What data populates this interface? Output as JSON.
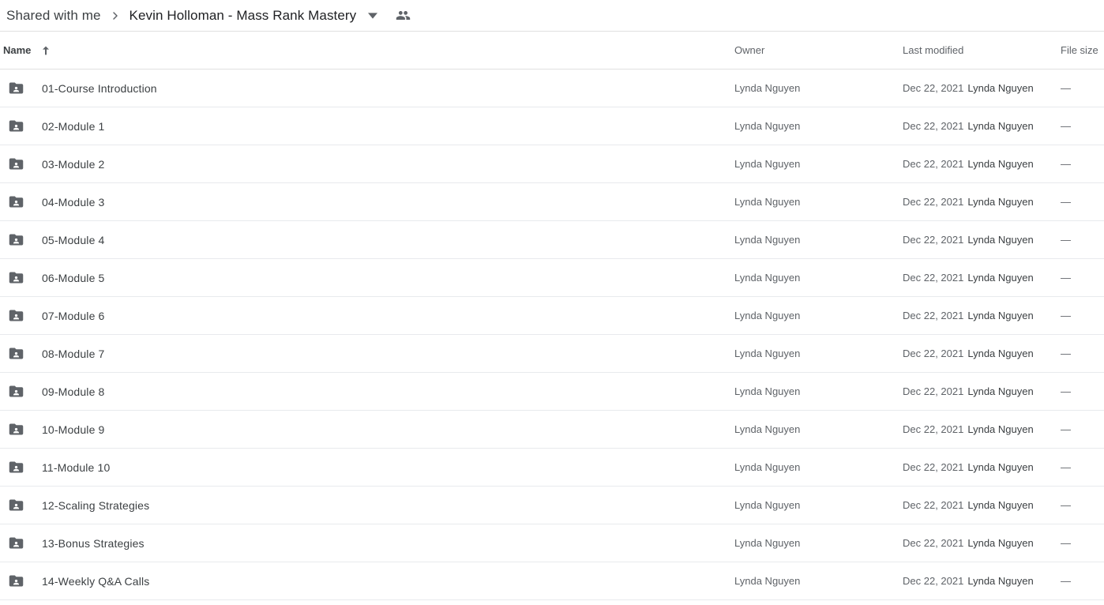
{
  "breadcrumb": {
    "root_label": "Shared with me",
    "separator_icon": "chevron-right-icon",
    "current_label": "Kevin Holloman - Mass Rank Mastery",
    "caret_icon": "chevron-down-icon",
    "people_icon": "people-icon"
  },
  "table": {
    "columns": {
      "name": "Name",
      "sort_icon": "arrow-up-icon",
      "owner": "Owner",
      "last_modified": "Last modified",
      "file_size": "File size"
    },
    "rows": [
      {
        "icon": "shared-folder-icon",
        "name": "01-Course Introduction",
        "owner": "Lynda Nguyen",
        "modified_date": "Dec 22, 2021",
        "modified_by": "Lynda Nguyen",
        "size": "—"
      },
      {
        "icon": "shared-folder-icon",
        "name": "02-Module 1",
        "owner": "Lynda Nguyen",
        "modified_date": "Dec 22, 2021",
        "modified_by": "Lynda Nguyen",
        "size": "—"
      },
      {
        "icon": "shared-folder-icon",
        "name": "03-Module 2",
        "owner": "Lynda Nguyen",
        "modified_date": "Dec 22, 2021",
        "modified_by": "Lynda Nguyen",
        "size": "—"
      },
      {
        "icon": "shared-folder-icon",
        "name": "04-Module 3",
        "owner": "Lynda Nguyen",
        "modified_date": "Dec 22, 2021",
        "modified_by": "Lynda Nguyen",
        "size": "—"
      },
      {
        "icon": "shared-folder-icon",
        "name": "05-Module 4",
        "owner": "Lynda Nguyen",
        "modified_date": "Dec 22, 2021",
        "modified_by": "Lynda Nguyen",
        "size": "—"
      },
      {
        "icon": "shared-folder-icon",
        "name": "06-Module 5",
        "owner": "Lynda Nguyen",
        "modified_date": "Dec 22, 2021",
        "modified_by": "Lynda Nguyen",
        "size": "—"
      },
      {
        "icon": "shared-folder-icon",
        "name": "07-Module 6",
        "owner": "Lynda Nguyen",
        "modified_date": "Dec 22, 2021",
        "modified_by": "Lynda Nguyen",
        "size": "—"
      },
      {
        "icon": "shared-folder-icon",
        "name": "08-Module 7",
        "owner": "Lynda Nguyen",
        "modified_date": "Dec 22, 2021",
        "modified_by": "Lynda Nguyen",
        "size": "—"
      },
      {
        "icon": "shared-folder-icon",
        "name": "09-Module 8",
        "owner": "Lynda Nguyen",
        "modified_date": "Dec 22, 2021",
        "modified_by": "Lynda Nguyen",
        "size": "—"
      },
      {
        "icon": "shared-folder-icon",
        "name": "10-Module 9",
        "owner": "Lynda Nguyen",
        "modified_date": "Dec 22, 2021",
        "modified_by": "Lynda Nguyen",
        "size": "—"
      },
      {
        "icon": "shared-folder-icon",
        "name": "11-Module 10",
        "owner": "Lynda Nguyen",
        "modified_date": "Dec 22, 2021",
        "modified_by": "Lynda Nguyen",
        "size": "—"
      },
      {
        "icon": "shared-folder-icon",
        "name": "12-Scaling Strategies",
        "owner": "Lynda Nguyen",
        "modified_date": "Dec 22, 2021",
        "modified_by": "Lynda Nguyen",
        "size": "—"
      },
      {
        "icon": "shared-folder-icon",
        "name": "13-Bonus Strategies",
        "owner": "Lynda Nguyen",
        "modified_date": "Dec 22, 2021",
        "modified_by": "Lynda Nguyen",
        "size": "—"
      },
      {
        "icon": "shared-folder-icon",
        "name": "14-Weekly Q&A Calls",
        "owner": "Lynda Nguyen",
        "modified_date": "Dec 22, 2021",
        "modified_by": "Lynda Nguyen",
        "size": "—"
      }
    ]
  },
  "colors": {
    "text_primary": "#3c4043",
    "text_secondary": "#5f6368",
    "divider": "#e8eaed",
    "background": "#ffffff",
    "icon_gray": "#5f6368"
  }
}
